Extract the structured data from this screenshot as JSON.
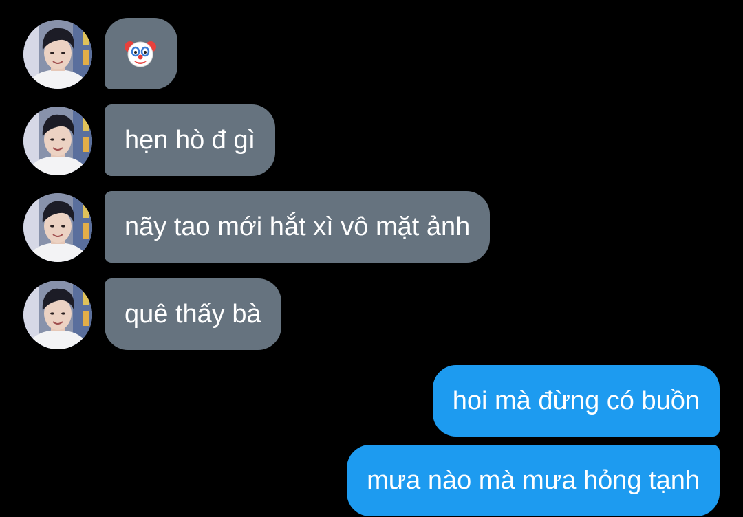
{
  "conversation": {
    "incoming": [
      {
        "type": "emoji",
        "icon": "clown-face-icon",
        "text": "🤡"
      },
      {
        "type": "text",
        "text": "hẹn hò đ gì"
      },
      {
        "type": "text",
        "text": "nãy tao mới hắt xì vô mặt ảnh"
      },
      {
        "type": "text",
        "text": "quê thấy bà"
      }
    ],
    "outgoing": [
      {
        "type": "text",
        "text": "hoi mà đừng có buồn"
      },
      {
        "type": "text",
        "text": "mưa nào mà mưa hỏng tạnh"
      }
    ]
  },
  "colors": {
    "background": "#000000",
    "incoming_bubble": "#66737f",
    "outgoing_bubble": "#1d9bf0",
    "text": "#ffffff"
  }
}
